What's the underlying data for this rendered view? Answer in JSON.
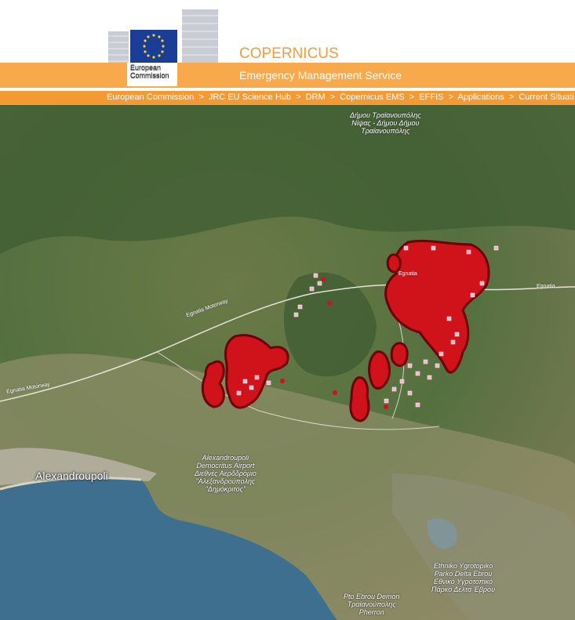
{
  "header": {
    "logo_text_line1": "European",
    "logo_text_line2": "Commission",
    "site_title": "COPERNICUS",
    "subtitle": "Emergency Management Service"
  },
  "breadcrumbs": [
    "European Commission",
    "JRC EU Science Hub",
    "DRM",
    "Copernicus EMS",
    "EFFIS",
    "Applications",
    "Current Situati"
  ],
  "breadcrumb_separator": ">",
  "map": {
    "city_label": "Alexandroupoli",
    "airport_label_line1": "Alexandroupoli",
    "airport_label_line2": "Democritus Airport",
    "airport_label_line3": "Διεθνές Αερδδρόμιο",
    "airport_label_line4": "\"Αλεξανδρούπολης",
    "airport_label_line5": "\"Δημόκριτος\"",
    "town_label_line1": "Δήμου Τραϊανουπόλης",
    "town_label_line2": "Νίψας - Δήμου Δήμου",
    "town_label_line3": "Τραϊανουπόλης",
    "park_label_line1": "Ethniko Ygrotopiko",
    "park_label_line2": "Parko Delta Ebrou",
    "park_label_line3": "Εθνικό Υγροτοπικό",
    "park_label_line4": "Πάρκο Δέλτα Έβρου",
    "south_label_line1": "Pto Ebrou Demon",
    "south_label_line2": "Τραϊανούπολης",
    "south_label_line3": "Pherron",
    "road_label_1": "Egnatia Motorway",
    "road_label_2": "Egnatia Motorway",
    "road_label_3": "Egnatia",
    "road_label_4": "Egnatia",
    "colors": {
      "burnt_area": "#d0121b",
      "burnt_outline": "#6e0008",
      "hotspot_pink": "#f4b6c8",
      "sea": "#3f6f8e"
    }
  }
}
